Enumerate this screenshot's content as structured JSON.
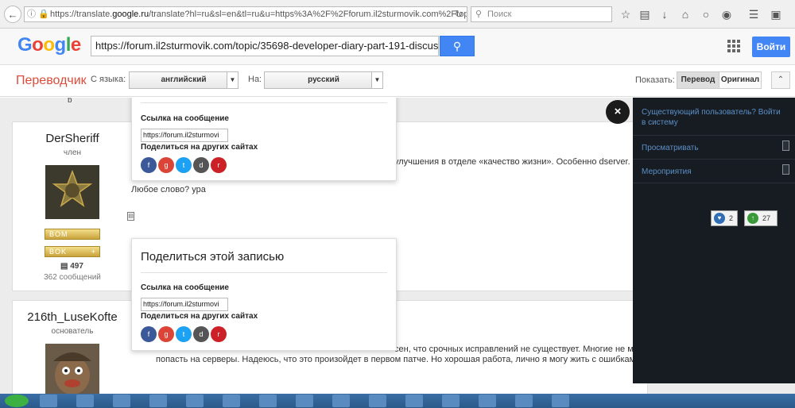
{
  "browser": {
    "url_prefix": "https://translate.",
    "url_host": "google.ru",
    "url_rest": "/translate?hl=ru&sl=en&tl=ru&u=https%3A%2F%2Fforum.il2sturmovik.com%2Ftopic%2F3569",
    "search_placeholder": "Поиск"
  },
  "google": {
    "logo_letters": [
      "G",
      "o",
      "o",
      "g",
      "l",
      "e"
    ],
    "url_input": "https://forum.il2sturmovik.com/topic/35698-developer-diary-part-191-discussion/",
    "login_label": "Войти"
  },
  "translator": {
    "title": "Переводчик",
    "from_label": "С языка:",
    "from_value": "английский",
    "to_label": "На:",
    "to_value": "русский",
    "show_label": "Показать:",
    "translation_label": "Перевод",
    "original_label": "Оригинал"
  },
  "top_fragment": "b",
  "posts": [
    {
      "author": "DerSheriff",
      "role": "член",
      "badges": [
        "BOM",
        "BOK"
      ],
      "reputation": "497",
      "posts_count": "362 сообщений",
      "text_line1": "улучшения в отделе «качество жизни». Особенно dserver. Оче",
      "text_line2": "Любое слово? ура"
    },
    {
      "author": "216th_LuseKofte",
      "role": "основатель",
      "text_line1": "сен, что срочных исправлений не существует. Многие не могу",
      "text_line2": "попасть на серверы. Надеюсь, что это произойдет в первом патче. Но хорошая работа, лично я могу жить с ошибками, кот"
    }
  ],
  "share_boxes": [
    {
      "title": "",
      "link_label": "Ссылка на сообщение",
      "link_value": "https://forum.il2sturmovi",
      "share_label": "Поделиться на других сайтах"
    },
    {
      "title": "Поделиться этой записью",
      "link_label": "Ссылка на сообщение",
      "link_value": "https://forum.il2sturmovi",
      "share_label": "Поделиться на других сайтах"
    }
  ],
  "social_icons": [
    "facebook-icon",
    "google-plus-icon",
    "twitter-icon",
    "digg-icon",
    "reddit-icon"
  ],
  "close_symbol": "×",
  "side_panel": {
    "login_prompt": "Существующий пользователь? Войти в систему",
    "browse": "Просматривать",
    "events": "Мероприятия"
  },
  "reactions": [
    {
      "name": "like",
      "count": "2"
    },
    {
      "name": "upvote",
      "count": "27"
    }
  ]
}
